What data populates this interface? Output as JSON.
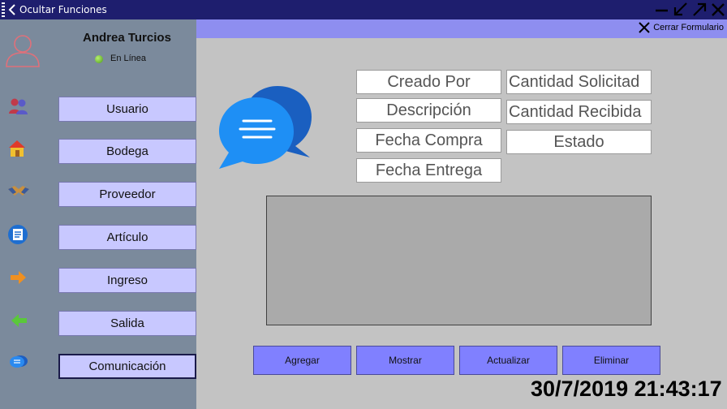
{
  "titlebar": {
    "toggle_label": "Ocultar Funciones"
  },
  "user": {
    "name": "Andrea Turcios",
    "status": "En Línea"
  },
  "nav": {
    "items": [
      {
        "label": "Usuario",
        "icon": "users-icon"
      },
      {
        "label": "Bodega",
        "icon": "warehouse-icon"
      },
      {
        "label": "Proveedor",
        "icon": "handshake-icon"
      },
      {
        "label": "Artículo",
        "icon": "article-icon"
      },
      {
        "label": "Ingreso",
        "icon": "arrow-right-icon"
      },
      {
        "label": "Salida",
        "icon": "arrow-left-icon"
      },
      {
        "label": "Comunicación",
        "icon": "chat-icon"
      }
    ],
    "active_index": 6
  },
  "header": {
    "close_form_label": "Cerrar Formulario"
  },
  "form": {
    "creado_por": "Creado Por",
    "descripcion": "Descripción",
    "fecha_compra": "Fecha Compra",
    "fecha_entrega": "Fecha Entrega",
    "cantidad_solicitada": "Cantidad Solicitad",
    "cantidad_recibida": "Cantidad Recibida",
    "estado": "Estado"
  },
  "actions": {
    "agregar": "Agregar",
    "mostrar": "Mostrar",
    "actualizar": "Actualizar",
    "eliminar": "Eliminar"
  },
  "clock": "30/7/2019 21:43:17",
  "colors": {
    "titlebar": "#1e1e6e",
    "sidebar": "#7b8a9c",
    "header_strip": "#8e8ef0",
    "nav_button": "#c8c8ff",
    "action_button": "#8080ff",
    "background": "#c3c3c3"
  }
}
